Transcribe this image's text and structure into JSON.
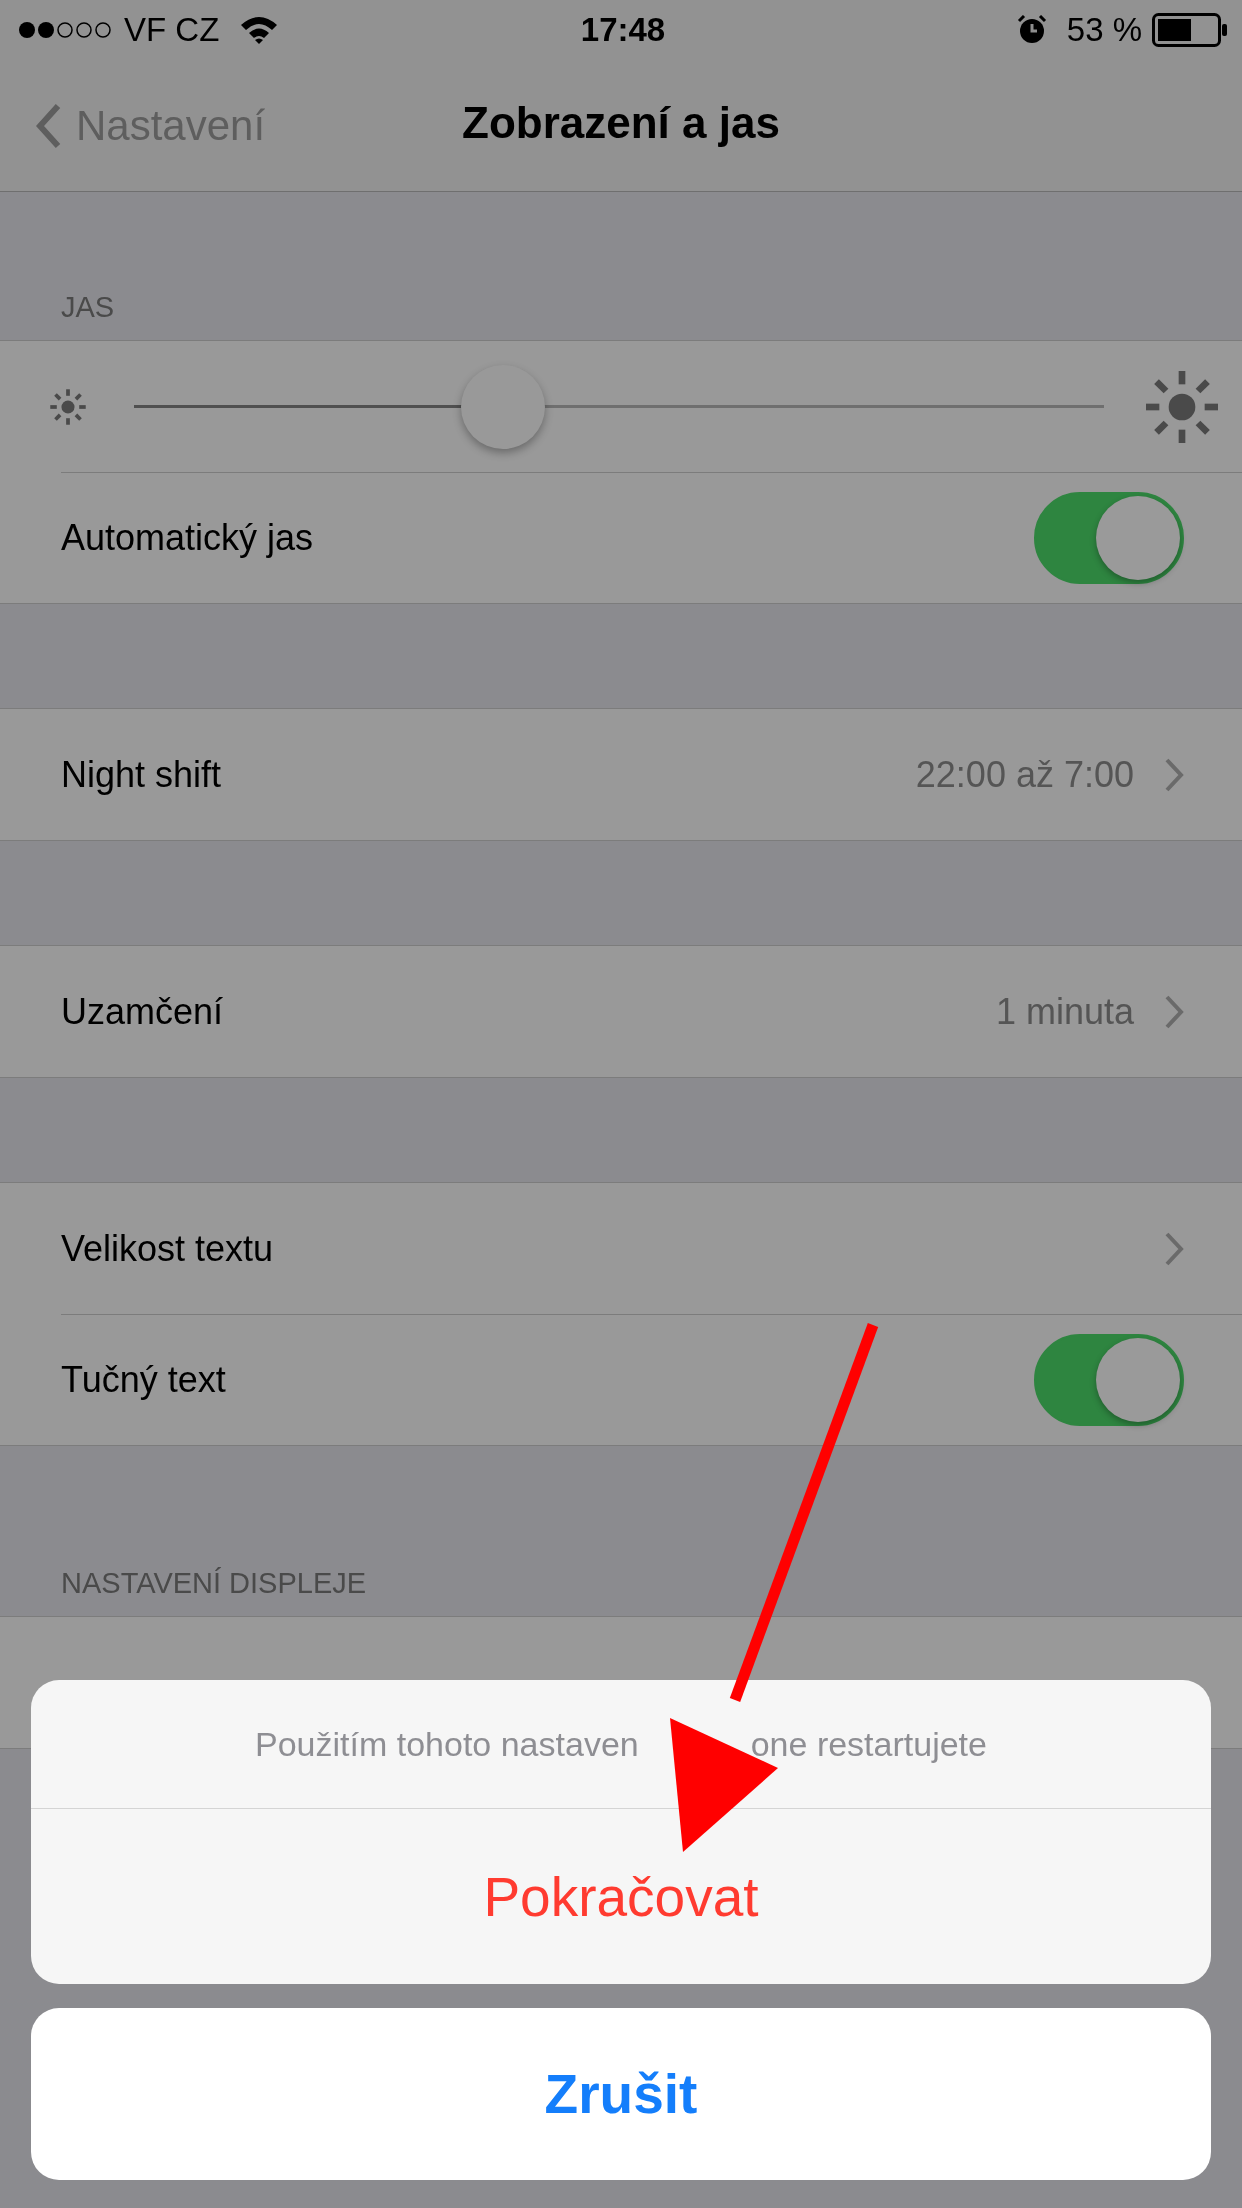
{
  "status_bar": {
    "carrier": "VF CZ",
    "time": "17:48",
    "battery": "53 %"
  },
  "nav": {
    "back": "Nastavení",
    "title": "Zobrazení a jas"
  },
  "sections": [
    {
      "header": "JAS",
      "rows": [
        {
          "kind": "slider",
          "level": 0.38
        },
        {
          "kind": "toggle",
          "label": "Automatický jas",
          "on": true
        }
      ]
    },
    {
      "rows": [
        {
          "kind": "link",
          "label": "Night shift",
          "value": "22:00 až 7:00"
        }
      ]
    },
    {
      "rows": [
        {
          "kind": "link",
          "label": "Uzamčení",
          "value": "1 minuta"
        }
      ]
    },
    {
      "rows": [
        {
          "kind": "link",
          "label": "Velikost textu"
        },
        {
          "kind": "toggle",
          "label": "Tučný text",
          "on": true
        }
      ]
    },
    {
      "header": "NASTAVENÍ DISPLEJE",
      "rows": [
        {
          "kind": "covered"
        }
      ]
    }
  ],
  "action_sheet": {
    "message_parts": [
      "Použitím tohoto nastaven",
      "one restartujete"
    ],
    "actions": [
      {
        "label": "Pokračovat",
        "kind": "destructive"
      }
    ],
    "cancel": "Zrušit"
  }
}
